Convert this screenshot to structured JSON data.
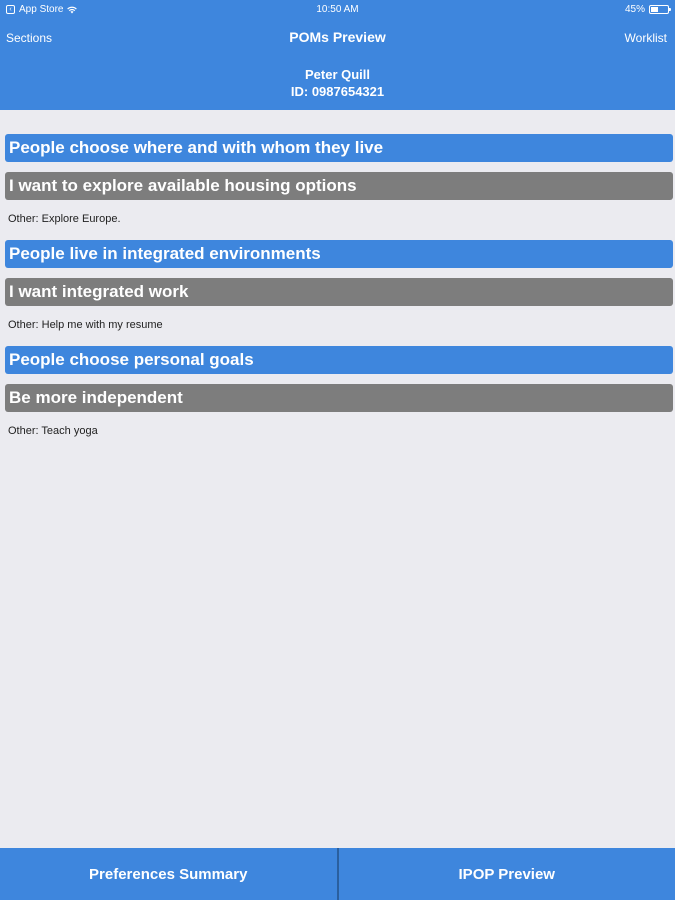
{
  "status_bar": {
    "carrier": "App Store",
    "time": "10:50 AM",
    "battery": "45%",
    "battery_level": 0.45
  },
  "nav": {
    "left_label": "Sections",
    "title": "POMs Preview",
    "right_label": "Worklist"
  },
  "patient": {
    "name": "Peter Quill",
    "id": "ID: 0987654321"
  },
  "sections": [
    {
      "header": "People choose where and with whom they live",
      "item": "I want to explore available housing options",
      "other": "Other: Explore Europe."
    },
    {
      "header": "People live in integrated environments",
      "item": "I want integrated work",
      "other": "Other: Help me with my resume"
    },
    {
      "header": "People choose personal goals",
      "item": "Be more independent",
      "other": "Other: Teach yoga"
    }
  ],
  "footer": {
    "left_button": "Preferences Summary",
    "right_button": "IPOP Preview"
  },
  "colors": {
    "primary_blue": "#3e86dd",
    "item_gray": "#7d7d7d",
    "background": "#ebebf0"
  }
}
